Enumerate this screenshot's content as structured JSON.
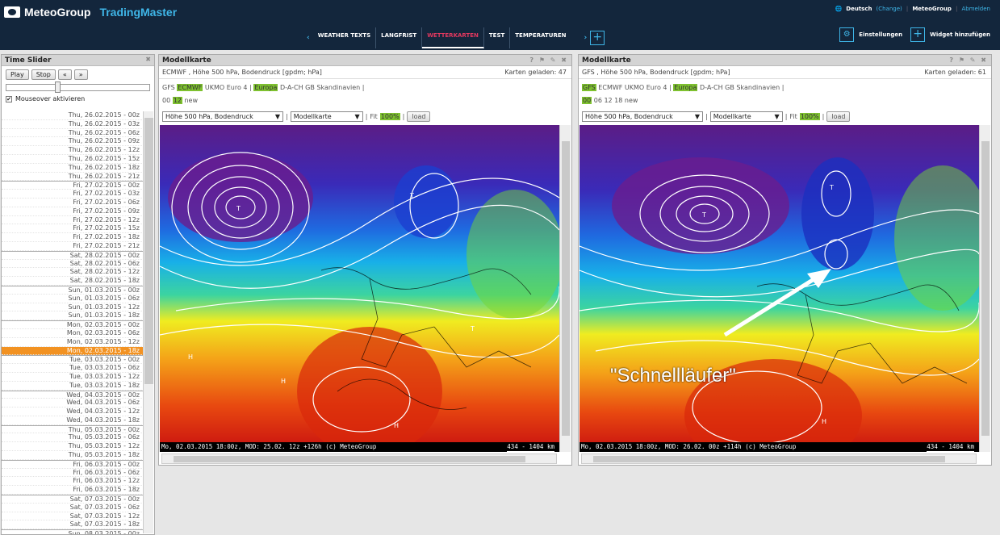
{
  "header": {
    "brand": "MeteoGroup",
    "product": "TradingMaster",
    "lang": "Deutsch",
    "change": "(Change)",
    "user": "MeteoGroup",
    "logout": "Abmelden"
  },
  "nav": {
    "tabs": [
      "WEATHER TEXTS",
      "LANGFRIST",
      "WETTERKARTEN",
      "TEST",
      "TEMPERATUREN"
    ],
    "settings": "Einstellungen",
    "add_widget": "Widget hinzufügen"
  },
  "timeslider": {
    "title": "Time Slider",
    "play": "Play",
    "stop": "Stop",
    "prev": "«",
    "next": "»",
    "mouseover": "Mouseover aktivieren",
    "items": [
      "Thu, 26.02.2015 - 00z",
      "Thu, 26.02.2015 - 03z",
      "Thu, 26.02.2015 - 06z",
      "Thu, 26.02.2015 - 09z",
      "Thu, 26.02.2015 - 12z",
      "Thu, 26.02.2015 - 15z",
      "Thu, 26.02.2015 - 18z",
      "Thu, 26.02.2015 - 21z",
      "Fri, 27.02.2015 - 00z",
      "Fri, 27.02.2015 - 03z",
      "Fri, 27.02.2015 - 06z",
      "Fri, 27.02.2015 - 09z",
      "Fri, 27.02.2015 - 12z",
      "Fri, 27.02.2015 - 15z",
      "Fri, 27.02.2015 - 18z",
      "Fri, 27.02.2015 - 21z",
      "Sat, 28.02.2015 - 00z",
      "Sat, 28.02.2015 - 06z",
      "Sat, 28.02.2015 - 12z",
      "Sat, 28.02.2015 - 18z",
      "Sun, 01.03.2015 - 00z",
      "Sun, 01.03.2015 - 06z",
      "Sun, 01.03.2015 - 12z",
      "Sun, 01.03.2015 - 18z",
      "Mon, 02.03.2015 - 00z",
      "Mon, 02.03.2015 - 06z",
      "Mon, 02.03.2015 - 12z",
      "Mon, 02.03.2015 - 18z",
      "Tue, 03.03.2015 - 00z",
      "Tue, 03.03.2015 - 06z",
      "Tue, 03.03.2015 - 12z",
      "Tue, 03.03.2015 - 18z",
      "Wed, 04.03.2015 - 00z",
      "Wed, 04.03.2015 - 06z",
      "Wed, 04.03.2015 - 12z",
      "Wed, 04.03.2015 - 18z",
      "Thu, 05.03.2015 - 00z",
      "Thu, 05.03.2015 - 06z",
      "Thu, 05.03.2015 - 12z",
      "Thu, 05.03.2015 - 18z",
      "Fri, 06.03.2015 - 00z",
      "Fri, 06.03.2015 - 06z",
      "Fri, 06.03.2015 - 12z",
      "Fri, 06.03.2015 - 18z",
      "Sat, 07.03.2015 - 00z",
      "Sat, 07.03.2015 - 06z",
      "Sat, 07.03.2015 - 12z",
      "Sat, 07.03.2015 - 18z",
      "Sun, 08.03.2015 - 00z"
    ],
    "active_index": 27
  },
  "map_left": {
    "title": "Modellkarte",
    "subtitle": "ECMWF , Höhe 500 hPa, Bodendruck [gpdm; hPa]",
    "loaded": "Karten geladen: 47",
    "models": "GFS",
    "model_sel": "ECMWF",
    "models2": "UKMO Euro 4 |",
    "region_sel": "Europa",
    "regions": "D-A-CH  GB  Skandinavien  |",
    "runs_a": "00",
    "run_sel": "12",
    "runs_b": "new",
    "param": "Höhe 500 hPa, Bodendruck",
    "type": "Modellkarte",
    "fit": "Fit",
    "zoom": "100%",
    "load": "load",
    "footer": "Mo, 02.03.2015 18:00z, MOD: 25.02. 12z +126h (c) MeteoGroup",
    "scale": "434 - 1404 km"
  },
  "map_right": {
    "title": "Modellkarte",
    "subtitle": "GFS , Höhe 500 hPa, Bodendruck [gpdm; hPa]",
    "loaded": "Karten geladen: 61",
    "model_sel": "GFS",
    "models2": "ECMWF  UKMO Euro 4 |",
    "region_sel": "Europa",
    "regions": "D-A-CH  GB  Skandinavien  |",
    "run_sel": "00",
    "runs_b": "06  12  18  new",
    "param": "Höhe 500 hPa, Bodendruck",
    "type": "Modellkarte",
    "fit": "Fit",
    "zoom": "100%",
    "load": "load",
    "footer": "Mo, 02.03.2015 18:00z, MOD: 26.02. 00z +114h (c) MeteoGroup",
    "scale": "434 - 1404 km",
    "annotation": "\"Schnellläufer\""
  },
  "colors": {
    "accent": "#3fb6e8",
    "active": "#f29222",
    "highlight": "#7ec12f"
  }
}
